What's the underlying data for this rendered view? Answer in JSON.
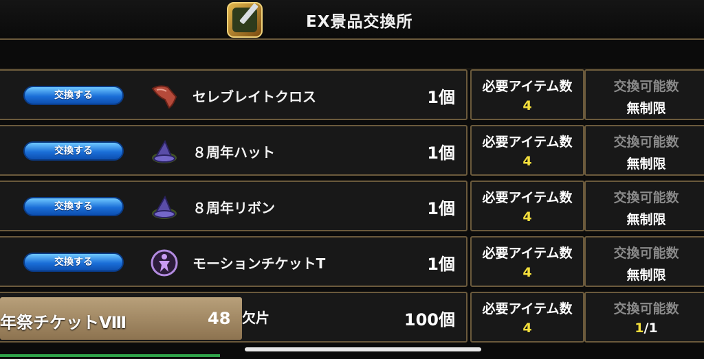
{
  "header": {
    "title": "EX景品交換所"
  },
  "columns": {
    "required_label": "必要アイテム数",
    "available_label": "交換可能数"
  },
  "rows": [
    {
      "button": "交換する",
      "name": "セレブレイトクロス",
      "qty": "1個",
      "required": "4",
      "available": "無制限",
      "icon": "cloth-icon"
    },
    {
      "button": "交換する",
      "name": "８周年ハット",
      "qty": "1個",
      "required": "4",
      "available": "無制限",
      "icon": "hat-icon"
    },
    {
      "button": "交換する",
      "name": "８周年リボン",
      "qty": "1個",
      "required": "4",
      "available": "無制限",
      "icon": "hat-icon"
    },
    {
      "button": "交換する",
      "name": "モーションチケットT",
      "qty": "1個",
      "required": "4",
      "available": "無制限",
      "icon": "motion-ticket-icon"
    }
  ],
  "last_row": {
    "ticket_name": "年祭チケットⅧ",
    "ticket_count": "48",
    "suffix": "欠片",
    "qty": "100個",
    "required": "4",
    "available_current": "1",
    "available_total": "/1"
  },
  "colors": {
    "accent_yellow": "#f5e03c",
    "button_blue": "#1b6fd8",
    "frame": "#6b5a3c"
  }
}
